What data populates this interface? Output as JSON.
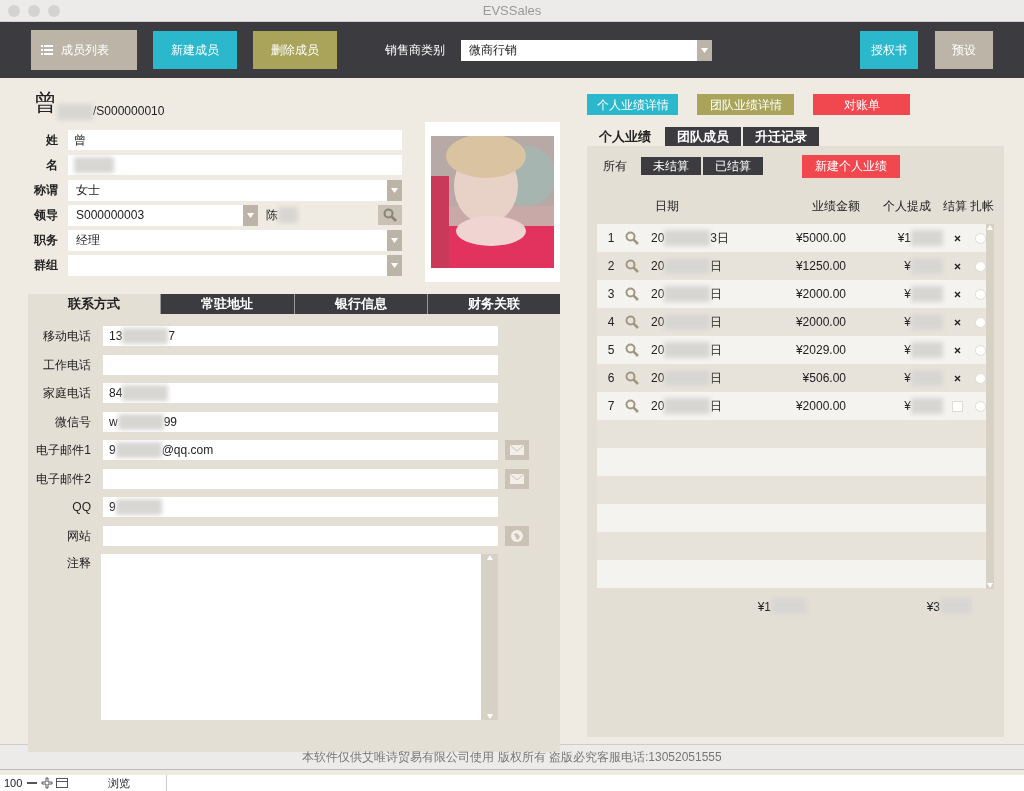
{
  "window": {
    "title": "EVSSales"
  },
  "toolbar": {
    "list_button": {
      "label": "成员列表"
    },
    "buttons": [
      {
        "label": "新建成员",
        "color": "#2bb8cc"
      },
      {
        "label": "删除成员",
        "color": "#a9a45a"
      }
    ],
    "dealer_type": {
      "label": "销售商类别",
      "value": "微商行销"
    },
    "right_buttons": [
      {
        "label": "授权书",
        "color": "#2bb8cc"
      },
      {
        "label": "预设",
        "color": "#bdb4a8"
      }
    ]
  },
  "member": {
    "header": [
      "曾",
      "/S000000010"
    ],
    "fields": [
      {
        "label": "姓",
        "kind": "text",
        "parts": [
          "曾"
        ]
      },
      {
        "label": "名",
        "kind": "masked"
      },
      {
        "label": "称谓",
        "kind": "select",
        "parts": [
          "女士"
        ]
      },
      {
        "label": "领导",
        "kind": "leader",
        "parts": [
          "S000000003"
        ],
        "leader_name": "陈"
      },
      {
        "label": "职务",
        "kind": "select",
        "parts": [
          "经理"
        ]
      },
      {
        "label": "群组",
        "kind": "select"
      }
    ],
    "photo": {
      "kind": "picture"
    }
  },
  "contact_tabs": [
    {
      "label": "联系方式",
      "selected": true
    },
    {
      "label": "常驻地址",
      "selected": false
    },
    {
      "label": "银行信息",
      "selected": false
    },
    {
      "label": "财务关联",
      "selected": false
    }
  ],
  "contact_fields": [
    {
      "label": "移动电话",
      "parts": [
        "13",
        "7"
      ],
      "kind": "plain"
    },
    {
      "label": "工作电话",
      "kind": "plain"
    },
    {
      "label": "家庭电话",
      "parts": [
        "84"
      ],
      "kind": "plain"
    },
    {
      "label": "微信号",
      "parts": [
        "w",
        "99"
      ],
      "kind": "plain"
    },
    {
      "label": "电子邮件1",
      "parts": [
        "9",
        "@qq.com"
      ],
      "kind": "mail"
    },
    {
      "label": "电子邮件2",
      "kind": "mail"
    },
    {
      "label": "QQ",
      "parts": [
        "9"
      ],
      "kind": "plain"
    },
    {
      "label": "网站",
      "kind": "web"
    }
  ],
  "notes": {
    "label": "注释"
  },
  "report_buttons": [
    {
      "label": "个人业绩详情",
      "color": "#2bb8cc"
    },
    {
      "label": "团队业绩详情",
      "color": "#a9a45a"
    },
    {
      "label": "对账单",
      "color": "#f0484e"
    }
  ],
  "perf_tabs": [
    {
      "label": "个人业绩",
      "selected": true
    },
    {
      "label": "团队成员",
      "selected": false
    },
    {
      "label": "升迁记录",
      "selected": false
    }
  ],
  "filters": [
    {
      "label": "所有",
      "selected": true
    },
    {
      "label": "未结算",
      "selected": false
    },
    {
      "label": "已结算",
      "selected": false
    }
  ],
  "new_record_button": {
    "label": "新建个人业绩"
  },
  "table": {
    "columns": [
      "日期",
      "业绩金额",
      "个人提成",
      "结算",
      "扎帐"
    ],
    "rows": [
      {
        "index": "1",
        "date": [
          "20",
          "3日"
        ],
        "amount": "¥5000.00",
        "commission": "¥1",
        "settled": true,
        "locked": false
      },
      {
        "index": "2",
        "date": [
          "20",
          "日"
        ],
        "amount": "¥1250.00",
        "commission": "¥",
        "settled": true,
        "locked": false
      },
      {
        "index": "3",
        "date": [
          "20",
          "日"
        ],
        "amount": "¥2000.00",
        "commission": "¥",
        "settled": true,
        "locked": false
      },
      {
        "index": "4",
        "date": [
          "20",
          "日"
        ],
        "amount": "¥2000.00",
        "commission": "¥",
        "settled": true,
        "locked": false
      },
      {
        "index": "5",
        "date": [
          "20",
          "日"
        ],
        "amount": "¥2029.00",
        "commission": "¥",
        "settled": true,
        "locked": false
      },
      {
        "index": "6",
        "date": [
          "20",
          "日"
        ],
        "amount": "¥506.00",
        "commission": "¥",
        "settled": true,
        "locked": false
      },
      {
        "index": "7",
        "date": [
          "20",
          "日"
        ],
        "amount": "¥2000.00",
        "commission": "¥",
        "settled": false,
        "locked": false
      }
    ],
    "totals": [
      "¥1",
      "¥3"
    ]
  },
  "footer": "本软件仅供艾唯诗贸易有限公司使用 版权所有 盗版必究客服电话:13052051555",
  "status_bar": {
    "zoom": "100",
    "mode": "浏览"
  }
}
